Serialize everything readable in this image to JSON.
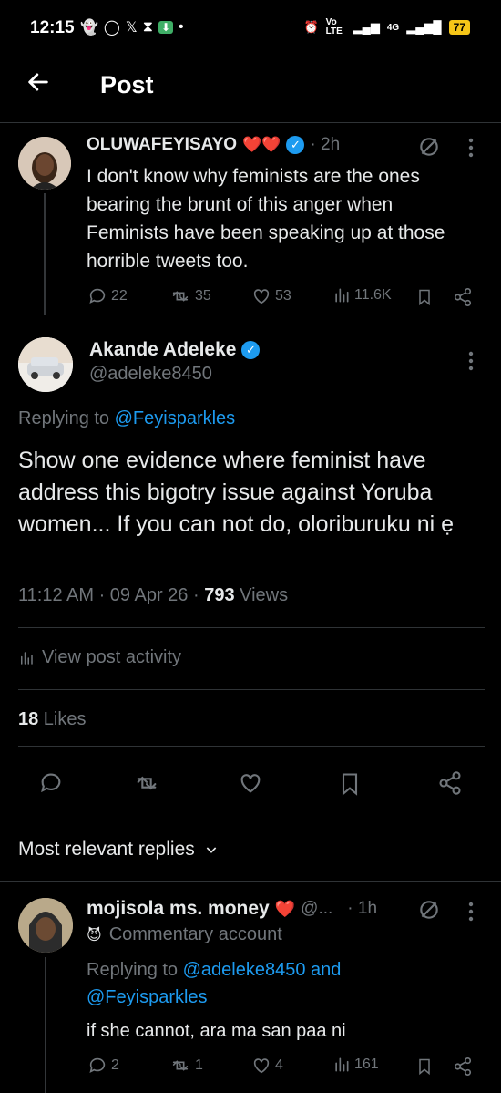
{
  "status_bar": {
    "time": "12:15",
    "left_icons": [
      "snapchat-icon",
      "whatsapp-icon",
      "x-icon",
      "hourglass-icon",
      "download-icon"
    ],
    "network": "Vo LTE",
    "signal": "4G",
    "battery": "77"
  },
  "header": {
    "title": "Post"
  },
  "parent_post": {
    "author": "OLUWAFEYISAYO",
    "hearts": "❤️❤️",
    "time": "· 2h",
    "text": "I don't know why feminists are the ones bearing the brunt of this anger when Feminists have been speaking up at those horrible tweets too.",
    "replies": "22",
    "reposts": "35",
    "likes": "53",
    "views": "11.6K"
  },
  "main_post": {
    "author": "Akande Adeleke",
    "handle": "@adeleke8450",
    "replying_prefix": "Replying to ",
    "replying_to": "@Feyisparkles",
    "text": "Show one evidence where feminist have address this bigotry issue against Yoruba women... If you can not do, oloriburuku ni ẹ",
    "meta_time": "11:12 AM · 09 Apr 26 · ",
    "views_count": "793",
    "views_label": " Views",
    "activity_label": "View post activity",
    "likes_count": "18",
    "likes_label": " Likes"
  },
  "replies_header": {
    "label": "Most relevant replies"
  },
  "reply": {
    "author": "mojisola ms. money",
    "heart": "❤️",
    "handle_truncated": "@...",
    "time": "· 1h",
    "badge_emoji": "😈",
    "badge_text": "Commentary account",
    "replying_prefix": "Replying to ",
    "replying_to_1": "@adeleke8450",
    "replying_and": " and",
    "replying_to_2": "@Feyisparkles",
    "text": "if she cannot, ara ma san paa ni",
    "replies": "2",
    "reposts": "1",
    "likes": "4",
    "views": "161"
  },
  "colors": {
    "background": "#000000",
    "accent": "#1d9bf0",
    "muted": "#71767b",
    "divider": "#2f3336",
    "heart": "#f91880"
  }
}
